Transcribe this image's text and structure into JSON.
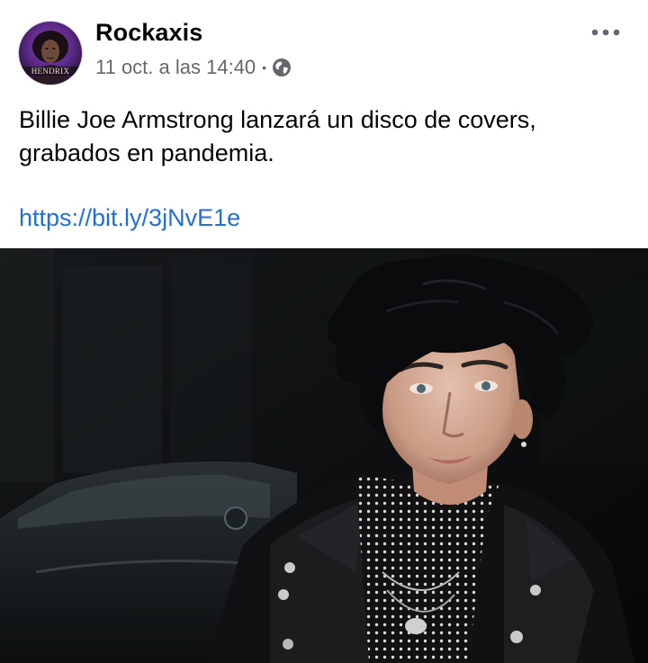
{
  "post": {
    "page_name": "Rockaxis",
    "timestamp": "11 oct. a las 14:40",
    "separator": "•",
    "privacy_icon": "globe-icon",
    "more_icon": "more-options-icon",
    "avatar_caption": "HENDRIX",
    "text": "Billie Joe Armstrong lanzará un disco de covers, grabados en pandemia.",
    "link": "https://bit.ly/3jNvE1e"
  },
  "colors": {
    "link": "#216fdb",
    "text": "#050505",
    "meta": "#65676b",
    "avatar_bg": "#5b2a86"
  }
}
